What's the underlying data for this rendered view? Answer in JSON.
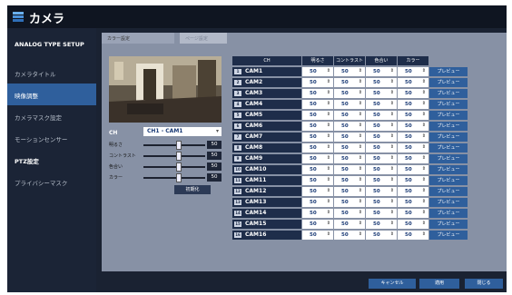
{
  "app": {
    "title": "カメラ"
  },
  "sidebar": {
    "header": "ANALOG TYPE SETUP",
    "items": [
      {
        "label": "カメラタイトル",
        "active": false
      },
      {
        "label": "映像調整",
        "active": true
      },
      {
        "label": "カメラマスク設定",
        "active": false
      },
      {
        "label": "モーションセンサー",
        "active": false
      },
      {
        "label": "PTZ設定",
        "active": false
      },
      {
        "label": "プライバシーマスク",
        "active": false
      }
    ]
  },
  "tabs": [
    {
      "label": "カラー設定",
      "active": true
    },
    {
      "label": "ページ設定",
      "active": false
    }
  ],
  "left_panel": {
    "ch_label": "CH",
    "ch_value": "CH1 - CAM1",
    "sliders": [
      {
        "label": "明るさ",
        "value": "50"
      },
      {
        "label": "コントラスト",
        "value": "50"
      },
      {
        "label": "色合い",
        "value": "50"
      },
      {
        "label": "カラー",
        "value": "50"
      }
    ],
    "init_button": "初期化"
  },
  "table": {
    "headers": [
      "CH",
      "明るさ",
      "コントラスト",
      "色合い",
      "カラー"
    ],
    "rows": [
      {
        "num": "1",
        "cam": "CAM1",
        "v": [
          "50",
          "50",
          "50",
          "50"
        ],
        "btn": "プレビュー"
      },
      {
        "num": "2",
        "cam": "CAM2",
        "v": [
          "50",
          "50",
          "50",
          "50"
        ],
        "btn": "プレビュー"
      },
      {
        "num": "3",
        "cam": "CAM3",
        "v": [
          "50",
          "50",
          "50",
          "50"
        ],
        "btn": "プレビュー"
      },
      {
        "num": "4",
        "cam": "CAM4",
        "v": [
          "50",
          "50",
          "50",
          "50"
        ],
        "btn": "プレビュー"
      },
      {
        "num": "5",
        "cam": "CAM5",
        "v": [
          "50",
          "50",
          "50",
          "50"
        ],
        "btn": "プレビュー"
      },
      {
        "num": "6",
        "cam": "CAM6",
        "v": [
          "50",
          "50",
          "50",
          "50"
        ],
        "btn": "プレビュー"
      },
      {
        "num": "7",
        "cam": "CAM7",
        "v": [
          "50",
          "50",
          "50",
          "50"
        ],
        "btn": "プレビュー"
      },
      {
        "num": "8",
        "cam": "CAM8",
        "v": [
          "50",
          "50",
          "50",
          "50"
        ],
        "btn": "プレビュー"
      },
      {
        "num": "9",
        "cam": "CAM9",
        "v": [
          "50",
          "50",
          "50",
          "50"
        ],
        "btn": "プレビュー"
      },
      {
        "num": "10",
        "cam": "CAM10",
        "v": [
          "50",
          "50",
          "50",
          "50"
        ],
        "btn": "プレビュー"
      },
      {
        "num": "11",
        "cam": "CAM11",
        "v": [
          "50",
          "50",
          "50",
          "50"
        ],
        "btn": "プレビュー"
      },
      {
        "num": "12",
        "cam": "CAM12",
        "v": [
          "50",
          "50",
          "50",
          "50"
        ],
        "btn": "プレビュー"
      },
      {
        "num": "13",
        "cam": "CAM13",
        "v": [
          "50",
          "50",
          "50",
          "50"
        ],
        "btn": "プレビュー"
      },
      {
        "num": "14",
        "cam": "CAM14",
        "v": [
          "50",
          "50",
          "50",
          "50"
        ],
        "btn": "プレビュー"
      },
      {
        "num": "15",
        "cam": "CAM15",
        "v": [
          "50",
          "50",
          "50",
          "50"
        ],
        "btn": "プレビュー"
      },
      {
        "num": "16",
        "cam": "CAM16",
        "v": [
          "50",
          "50",
          "50",
          "50"
        ],
        "btn": "プレビュー"
      }
    ]
  },
  "footer": {
    "cancel": "キャンセル",
    "apply": "適用",
    "close": "閉じる"
  },
  "icons": {
    "app": "camera-icon",
    "spinner": "spinner-arrows-icon",
    "dropdown": "dropdown-arrow-icon"
  },
  "colors": {
    "accent": "#2f5f9c",
    "header_bg": "#1e2d4a",
    "panel_bg": "#8791a5"
  }
}
